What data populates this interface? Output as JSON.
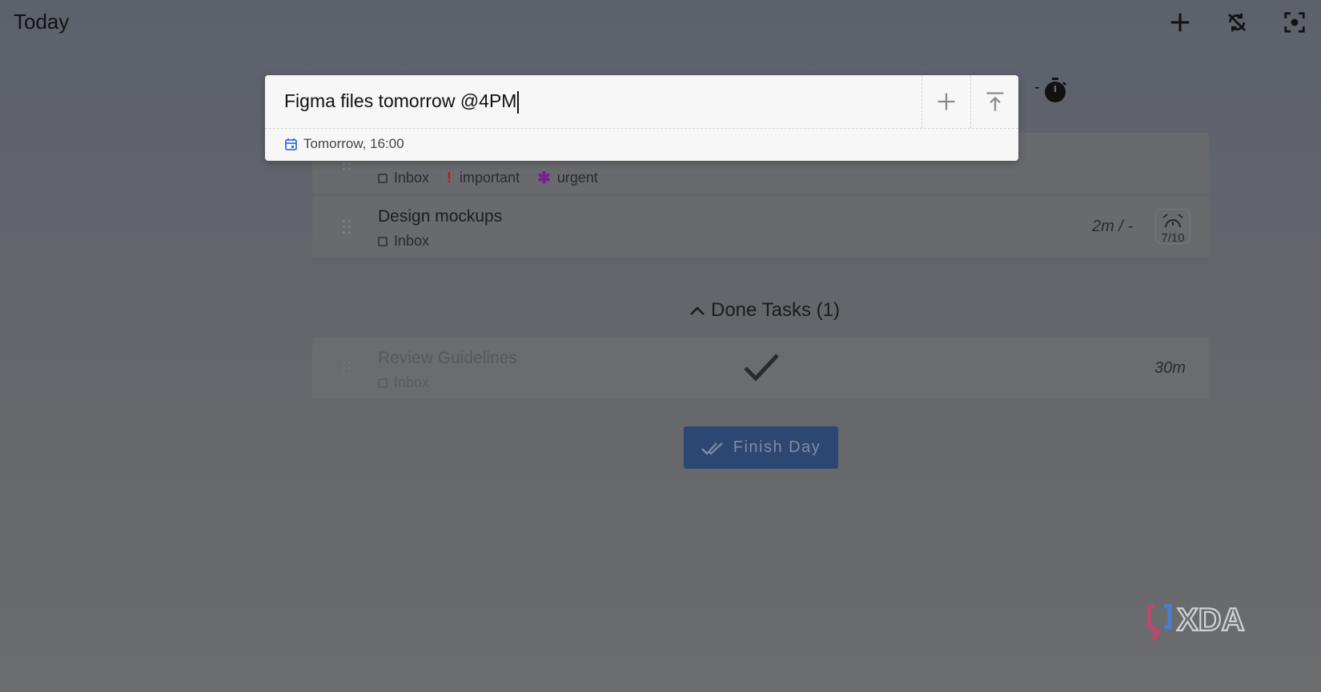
{
  "header": {
    "title": "Today",
    "icons": [
      "add-icon",
      "sync-off-icon",
      "focus-mode-icon"
    ]
  },
  "timer": {
    "dash": "-",
    "icon": "stopwatch-icon"
  },
  "add_task": {
    "input_value": "Figma files tomorrow @4PM",
    "add_icon": "plus-icon",
    "add_top_icon": "add-to-top-icon",
    "due_label": "Tomorrow, 16:00",
    "due_icon": "calendar-icon"
  },
  "tasks": [
    {
      "title": "",
      "tags": {
        "project": "Inbox",
        "tag1": "important",
        "tag2": "urgent"
      }
    },
    {
      "title": "Design mockups",
      "tags": {
        "project": "Inbox"
      },
      "time": "2m / -",
      "repeat_count": "7/10"
    }
  ],
  "done_section": {
    "toggle_label": "Done Tasks (1)",
    "tasks": [
      {
        "title": "Review Guidelines",
        "project": "Inbox",
        "time": "30m"
      }
    ]
  },
  "finish_button": {
    "label": "Finish Day"
  },
  "watermark": {
    "text": "XDA"
  },
  "colors": {
    "accent": "#2d4773",
    "important": "#c0161b",
    "urgent": "#7a1f91",
    "calendar": "#3a6fd8"
  }
}
